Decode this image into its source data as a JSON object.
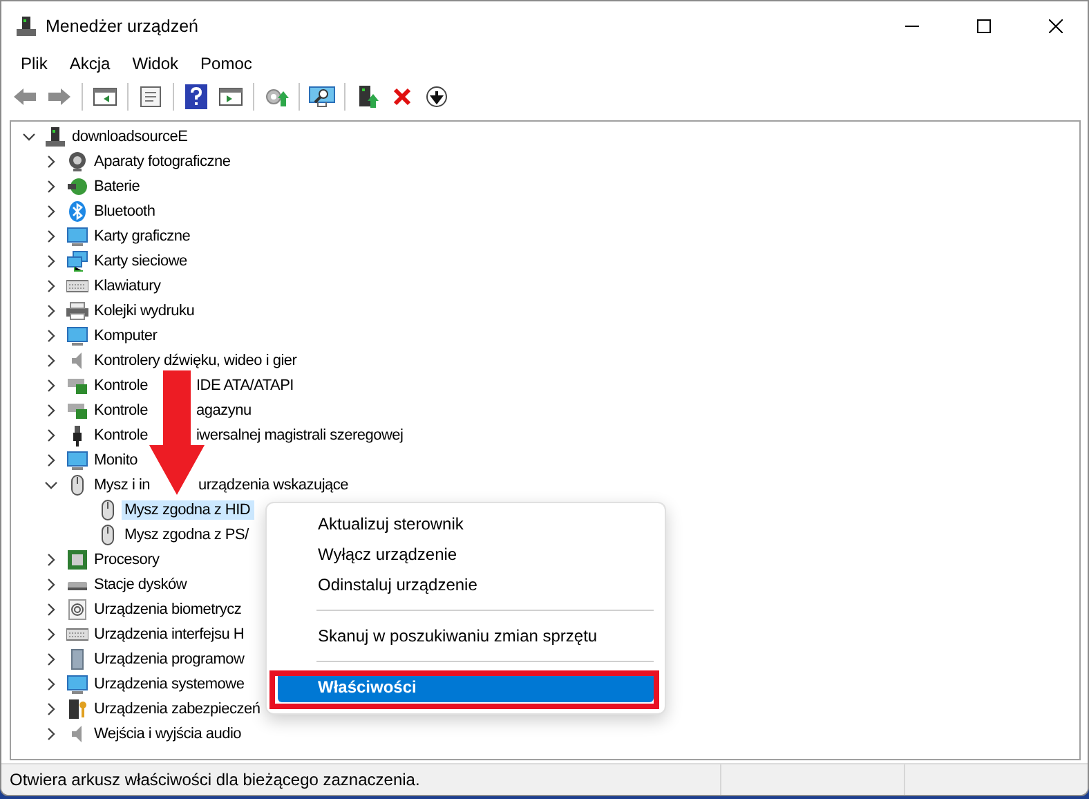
{
  "window": {
    "title": "Menedżer urządzeń"
  },
  "menu": [
    "Plik",
    "Akcja",
    "Widok",
    "Pomoc"
  ],
  "toolbar": [
    {
      "kind": "back",
      "disabled": true
    },
    {
      "kind": "forward",
      "disabled": true
    },
    {
      "kind": "sep"
    },
    {
      "kind": "panel"
    },
    {
      "kind": "sep"
    },
    {
      "kind": "sheet"
    },
    {
      "kind": "sep"
    },
    {
      "kind": "help"
    },
    {
      "kind": "panel2"
    },
    {
      "kind": "sep"
    },
    {
      "kind": "update"
    },
    {
      "kind": "sep"
    },
    {
      "kind": "scan"
    },
    {
      "kind": "sep"
    },
    {
      "kind": "add"
    },
    {
      "kind": "remove"
    },
    {
      "kind": "down"
    }
  ],
  "tree": {
    "label": "downloadsourceE",
    "expanded": true,
    "children": [
      {
        "label": "Aparaty fotograficzne",
        "expanded": false
      },
      {
        "label": "Baterie",
        "expanded": false
      },
      {
        "label": "Bluetooth",
        "expanded": false
      },
      {
        "label": "Karty graficzne",
        "expanded": false
      },
      {
        "label": "Karty sieciowe",
        "expanded": false
      },
      {
        "label": "Klawiatury",
        "expanded": false
      },
      {
        "label": "Kolejki wydruku",
        "expanded": false
      },
      {
        "label": "Komputer",
        "expanded": false
      },
      {
        "label": "Kontrolery dźwięku, wideo i gier",
        "expanded": false
      },
      {
        "label": "Kontrole",
        "label_rest": "IDE ATA/ATAPI",
        "expanded": false
      },
      {
        "label": "Kontrole",
        "label_rest": "agazynu",
        "expanded": false
      },
      {
        "label": "Kontrole",
        "label_rest": "iwersalnej magistrali szeregowej",
        "expanded": false
      },
      {
        "label": "Monito",
        "expanded": false
      },
      {
        "label": "Mysz i in",
        "label_rest": "urządzenia wskazujące",
        "expanded": true,
        "children": [
          {
            "label": "Mysz zgodna z HID",
            "selected": true
          },
          {
            "label": "Mysz zgodna z PS/",
            "selected": false
          }
        ]
      },
      {
        "label": "Procesory",
        "expanded": false
      },
      {
        "label": "Stacje dysków",
        "expanded": false
      },
      {
        "label": "Urządzenia biometrycz",
        "expanded": false
      },
      {
        "label": "Urządzenia interfejsu H",
        "expanded": false
      },
      {
        "label": "Urządzenia programow",
        "expanded": false
      },
      {
        "label": "Urządzenia systemowe",
        "expanded": false
      },
      {
        "label": "Urządzenia zabezpieczeń",
        "expanded": false
      },
      {
        "label": "Wejścia i wyjścia audio",
        "expanded": false
      }
    ]
  },
  "context_menu": [
    {
      "kind": "item",
      "label": "Aktualizuj sterownik",
      "selected": false
    },
    {
      "kind": "item",
      "label": "Wyłącz urządzenie",
      "selected": false
    },
    {
      "kind": "item",
      "label": "Odinstaluj urządzenie",
      "selected": false
    },
    {
      "kind": "separator"
    },
    {
      "kind": "item",
      "label": "Skanuj w poszukiwaniu zmian sprzętu",
      "selected": false
    },
    {
      "kind": "separator"
    },
    {
      "kind": "item",
      "label": "Właściwości",
      "selected": true
    }
  ],
  "status_bar": {
    "text": "Otwiera arkusz właściwości dla bieżącego zaznaczenia."
  }
}
